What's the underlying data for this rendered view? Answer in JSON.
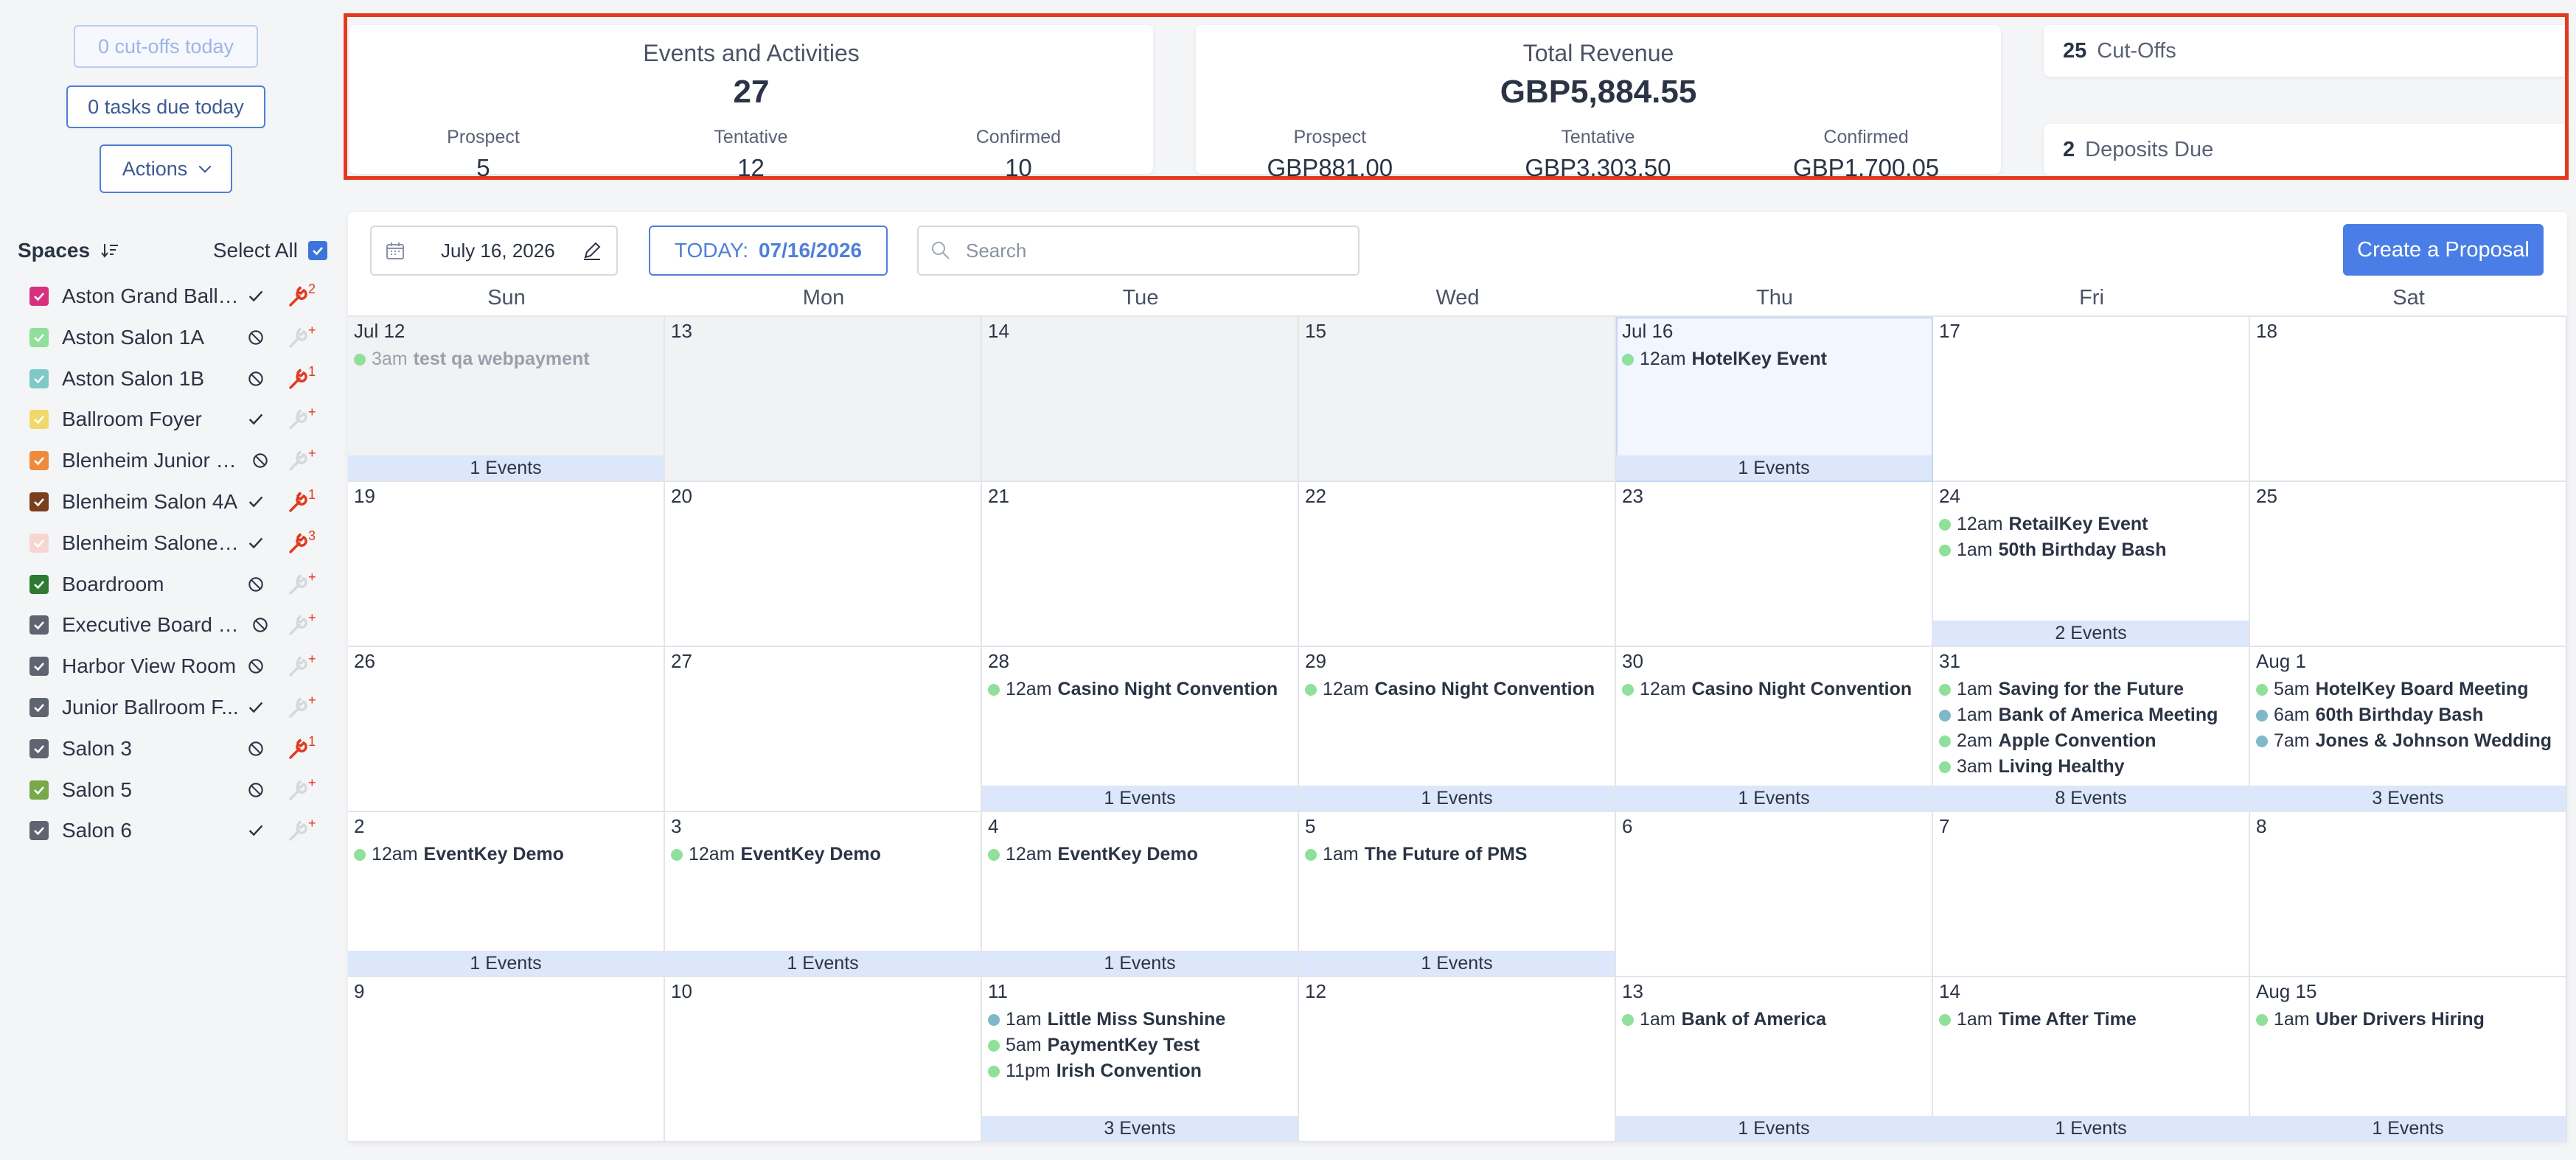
{
  "sidebar": {
    "cutoffs_button": "0 cut-offs today",
    "tasks_button": "0 tasks due today",
    "actions_button": "Actions",
    "spaces_title": "Spaces",
    "select_all_label": "Select All",
    "spaces": [
      {
        "name": "Aston Grand Ballr...",
        "color": "#d6307e",
        "status": "check",
        "tool": "active",
        "tool_count": "2"
      },
      {
        "name": "Aston Salon 1A",
        "color": "#8fe09a",
        "status": "blocked",
        "tool": "inactive",
        "tool_count": "+"
      },
      {
        "name": "Aston Salon 1B",
        "color": "#7cc9c8",
        "status": "blocked",
        "tool": "active",
        "tool_count": "1"
      },
      {
        "name": "Ballroom Foyer",
        "color": "#f0d96a",
        "status": "check",
        "tool": "inactive",
        "tool_count": "+"
      },
      {
        "name": "Blenheim Junior B...",
        "color": "#ee8a3c",
        "status": "blocked",
        "tool": "inactive",
        "tool_count": "+"
      },
      {
        "name": "Blenheim Salon 4A",
        "color": "#7a3f1c",
        "status": "check",
        "tool": "active",
        "tool_count": "1"
      },
      {
        "name": "Blenheim Salone ...",
        "color": "#f6d7cf",
        "status": "check",
        "tool": "active",
        "tool_count": "3"
      },
      {
        "name": "Boardroom",
        "color": "#2f7a33",
        "status": "blocked",
        "tool": "inactive",
        "tool_count": "+"
      },
      {
        "name": "Executive Board R...",
        "color": "#5f6470",
        "status": "blocked",
        "tool": "inactive",
        "tool_count": "+"
      },
      {
        "name": "Harbor View Room",
        "color": "#5f6470",
        "status": "blocked",
        "tool": "inactive",
        "tool_count": "+"
      },
      {
        "name": "Junior Ballroom F...",
        "color": "#5f6470",
        "status": "check",
        "tool": "inactive",
        "tool_count": "+"
      },
      {
        "name": "Salon 3",
        "color": "#5f6470",
        "status": "blocked",
        "tool": "active",
        "tool_count": "1"
      },
      {
        "name": "Salon 5",
        "color": "#78a849",
        "status": "blocked",
        "tool": "inactive",
        "tool_count": "+"
      },
      {
        "name": "Salon 6",
        "color": "#5f6470",
        "status": "check",
        "tool": "inactive",
        "tool_count": "+"
      }
    ]
  },
  "summary": {
    "events": {
      "title": "Events and Activities",
      "total": "27",
      "prospect_label": "Prospect",
      "prospect_value": "5",
      "tentative_label": "Tentative",
      "tentative_value": "12",
      "confirmed_label": "Confirmed",
      "confirmed_value": "10"
    },
    "revenue": {
      "title": "Total Revenue",
      "total": "GBP5,884.55",
      "prospect_label": "Prospect",
      "prospect_value": "GBP881.00",
      "tentative_label": "Tentative",
      "tentative_value": "GBP3,303.50",
      "confirmed_label": "Confirmed",
      "confirmed_value": "GBP1,700.05"
    },
    "cutoffs": {
      "count": "25",
      "label": "Cut-Offs"
    },
    "deposits": {
      "count": "2",
      "label": "Deposits Due"
    }
  },
  "toolbar": {
    "date_value": "July 16, 2026",
    "today_label": "TODAY:",
    "today_date": "07/16/2026",
    "search_placeholder": "Search",
    "create_button": "Create a Proposal"
  },
  "calendar": {
    "weekdays": [
      "Sun",
      "Mon",
      "Tue",
      "Wed",
      "Thu",
      "Fri",
      "Sat"
    ],
    "colors": {
      "green": "#8fe09a",
      "teal": "#7fb8c9"
    },
    "weeks": [
      [
        {
          "date": "Jul 12",
          "state": "out",
          "events": [
            {
              "time": "3am",
              "title": "test qa webpayment",
              "dot": "green"
            }
          ],
          "count": "1 Events"
        },
        {
          "date": "13",
          "state": "out",
          "events": [],
          "count": ""
        },
        {
          "date": "14",
          "state": "out",
          "events": [],
          "count": ""
        },
        {
          "date": "15",
          "state": "out",
          "events": [],
          "count": ""
        },
        {
          "date": "Jul 16",
          "state": "today",
          "events": [
            {
              "time": "12am",
              "title": "HotelKey Event",
              "dot": "green"
            }
          ],
          "count": "1 Events"
        },
        {
          "date": "17",
          "state": "",
          "events": [],
          "count": ""
        },
        {
          "date": "18",
          "state": "",
          "events": [],
          "count": ""
        }
      ],
      [
        {
          "date": "19",
          "state": "",
          "events": [],
          "count": ""
        },
        {
          "date": "20",
          "state": "",
          "events": [],
          "count": ""
        },
        {
          "date": "21",
          "state": "",
          "events": [],
          "count": ""
        },
        {
          "date": "22",
          "state": "",
          "events": [],
          "count": ""
        },
        {
          "date": "23",
          "state": "",
          "events": [],
          "count": ""
        },
        {
          "date": "24",
          "state": "",
          "events": [
            {
              "time": "12am",
              "title": "RetailKey Event",
              "dot": "green"
            },
            {
              "time": "1am",
              "title": "50th Birthday Bash",
              "dot": "green"
            }
          ],
          "count": "2 Events"
        },
        {
          "date": "25",
          "state": "",
          "events": [],
          "count": ""
        }
      ],
      [
        {
          "date": "26",
          "state": "",
          "events": [],
          "count": ""
        },
        {
          "date": "27",
          "state": "",
          "events": [],
          "count": ""
        },
        {
          "date": "28",
          "state": "",
          "events": [
            {
              "time": "12am",
              "title": "Casino Night Convention",
              "dot": "green"
            }
          ],
          "count": "1 Events"
        },
        {
          "date": "29",
          "state": "",
          "events": [
            {
              "time": "12am",
              "title": "Casino Night Convention",
              "dot": "green"
            }
          ],
          "count": "1 Events"
        },
        {
          "date": "30",
          "state": "",
          "events": [
            {
              "time": "12am",
              "title": "Casino Night Convention",
              "dot": "green"
            }
          ],
          "count": "1 Events"
        },
        {
          "date": "31",
          "state": "",
          "events": [
            {
              "time": "1am",
              "title": "Saving for the Future",
              "dot": "green"
            },
            {
              "time": "1am",
              "title": "Bank of America Meeting",
              "dot": "teal"
            },
            {
              "time": "2am",
              "title": "Apple Convention",
              "dot": "green"
            },
            {
              "time": "3am",
              "title": "Living Healthy",
              "dot": "green"
            }
          ],
          "count": "8 Events"
        },
        {
          "date": "Aug 1",
          "state": "",
          "events": [
            {
              "time": "5am",
              "title": "HotelKey Board Meeting",
              "dot": "green"
            },
            {
              "time": "6am",
              "title": "60th Birthday Bash",
              "dot": "teal"
            },
            {
              "time": "7am",
              "title": "Jones & Johnson Wedding",
              "dot": "teal"
            }
          ],
          "count": "3 Events"
        }
      ],
      [
        {
          "date": "2",
          "state": "",
          "events": [
            {
              "time": "12am",
              "title": "EventKey Demo",
              "dot": "green"
            }
          ],
          "count": "1 Events"
        },
        {
          "date": "3",
          "state": "",
          "events": [
            {
              "time": "12am",
              "title": "EventKey Demo",
              "dot": "green"
            }
          ],
          "count": "1 Events"
        },
        {
          "date": "4",
          "state": "",
          "events": [
            {
              "time": "12am",
              "title": "EventKey Demo",
              "dot": "green"
            }
          ],
          "count": "1 Events"
        },
        {
          "date": "5",
          "state": "",
          "events": [
            {
              "time": "1am",
              "title": "The Future of PMS",
              "dot": "green"
            }
          ],
          "count": "1 Events"
        },
        {
          "date": "6",
          "state": "",
          "events": [],
          "count": ""
        },
        {
          "date": "7",
          "state": "",
          "events": [],
          "count": ""
        },
        {
          "date": "8",
          "state": "",
          "events": [],
          "count": ""
        }
      ],
      [
        {
          "date": "9",
          "state": "",
          "events": [],
          "count": ""
        },
        {
          "date": "10",
          "state": "",
          "events": [],
          "count": ""
        },
        {
          "date": "11",
          "state": "",
          "events": [
            {
              "time": "1am",
              "title": "Little Miss Sunshine",
              "dot": "teal"
            },
            {
              "time": "5am",
              "title": "PaymentKey Test",
              "dot": "green"
            },
            {
              "time": "11pm",
              "title": "Irish Convention",
              "dot": "green"
            }
          ],
          "count": "3 Events"
        },
        {
          "date": "12",
          "state": "",
          "events": [],
          "count": ""
        },
        {
          "date": "13",
          "state": "",
          "events": [
            {
              "time": "1am",
              "title": "Bank of America",
              "dot": "green"
            }
          ],
          "count": "1 Events"
        },
        {
          "date": "14",
          "state": "",
          "events": [
            {
              "time": "1am",
              "title": "Time After Time",
              "dot": "green"
            }
          ],
          "count": "1 Events"
        },
        {
          "date": "Aug 15",
          "state": "",
          "events": [
            {
              "time": "1am",
              "title": "Uber Drivers Hiring",
              "dot": "green"
            }
          ],
          "count": "1 Events"
        }
      ]
    ]
  }
}
